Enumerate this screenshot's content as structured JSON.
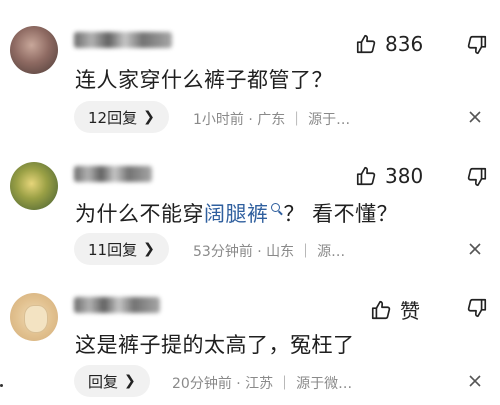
{
  "comments": [
    {
      "text": "连人家穿什么裤子都管了？",
      "like_count": "836",
      "reply_label": "12回复",
      "meta": "1小时前 · 广东 ｜ 源于…",
      "link_text": ""
    },
    {
      "text_before": "为什么不能穿",
      "link_text": "阔腿裤",
      "text_after": "？ 看不懂？",
      "like_count": "380",
      "reply_label": "11回复",
      "meta": "53分钟前 · 山东 ｜ 源…"
    },
    {
      "text": "这是裤子提的太高了，冤枉了",
      "like_count": "赞",
      "reply_label": "回复",
      "meta": "20分钟前 · 江苏 ｜ 源于微…"
    }
  ],
  "icons": {
    "like": "thumbs-up-icon",
    "dislike": "thumbs-down-icon",
    "more": "close-icon",
    "chevron": "chevron-right-icon",
    "search": "search-icon"
  },
  "colors": {
    "link": "#2f5f9e",
    "meta": "#8a8a8a",
    "pill_bg": "#f1f1f1"
  }
}
